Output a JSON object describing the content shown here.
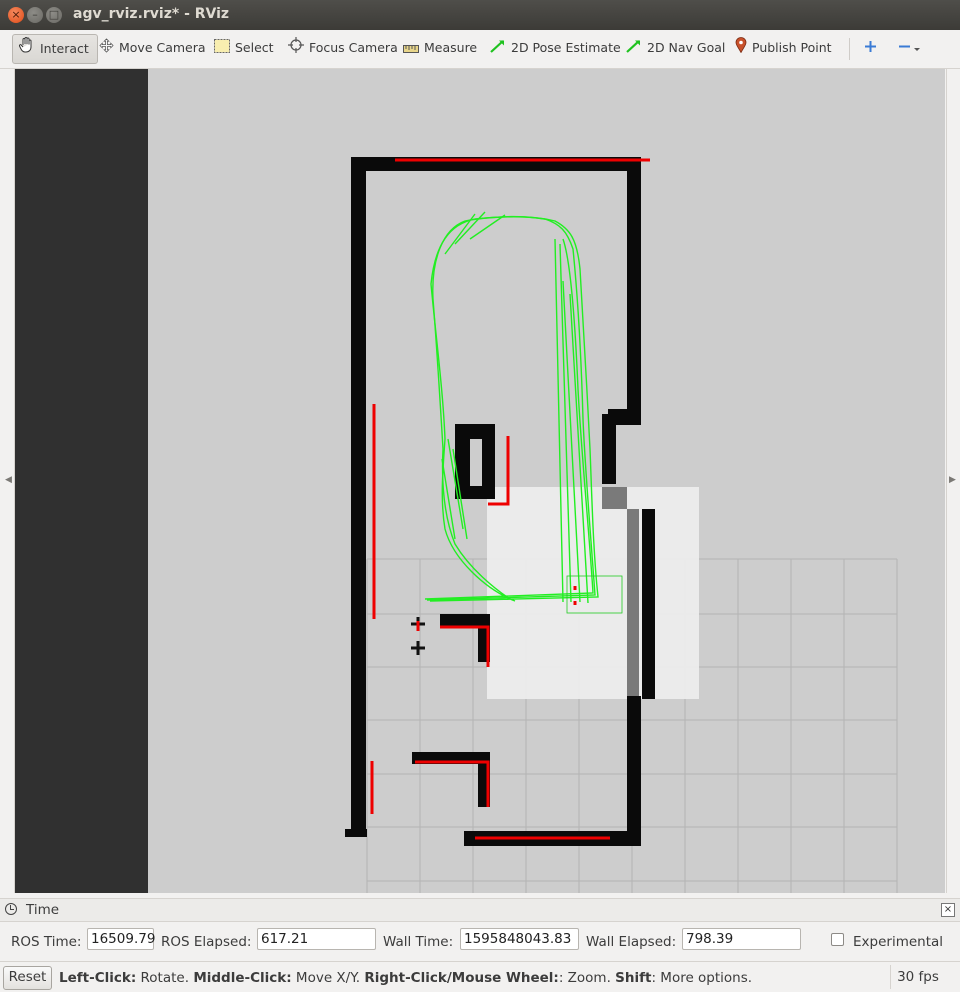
{
  "window": {
    "title": "agv_rviz.rviz* - RViz"
  },
  "window_controls": {
    "close": "×",
    "minimize": "–",
    "maximize": "□"
  },
  "toolbar": {
    "tools": [
      {
        "label": "Interact",
        "icon": "hand-icon",
        "active": true
      },
      {
        "label": "Move Camera",
        "icon": "move-camera-icon"
      },
      {
        "label": "Select",
        "icon": "select-box-icon"
      },
      {
        "label": "Focus Camera",
        "icon": "crosshair-icon"
      },
      {
        "label": "Measure",
        "icon": "ruler-icon"
      },
      {
        "label": "2D Pose Estimate",
        "icon": "green-arrow-icon"
      },
      {
        "label": "2D Nav Goal",
        "icon": "green-arrow-icon"
      },
      {
        "label": "Publish Point",
        "icon": "map-pin-icon"
      }
    ],
    "add_tool_icon": "plus-icon",
    "remove_tool_icon": "minus-icon"
  },
  "viewport": {
    "content": "2D occupancy grid map with laser scan (red), robot trajectory (green), costmap (white) and grid",
    "colors": {
      "background": "#303030",
      "map_free": "#cdcdcd",
      "walls": "#000000",
      "laser": "#ff0000",
      "path": "#00ff00"
    }
  },
  "time_panel": {
    "title": "Time",
    "ros_time_label": "ROS Time:",
    "ros_time": "16509.79",
    "ros_elapsed_label": "ROS Elapsed:",
    "ros_elapsed": "617.21",
    "wall_time_label": "Wall Time:",
    "wall_time": "1595848043.83",
    "wall_elapsed_label": "Wall Elapsed:",
    "wall_elapsed": "798.39",
    "experimental_label": "Experimental",
    "experimental_checked": false
  },
  "status_bar": {
    "reset_label": "Reset",
    "hint_parts": [
      {
        "b": "Left-Click:",
        "t": " Rotate. "
      },
      {
        "b": "Middle-Click:",
        "t": " Move X/Y. "
      },
      {
        "b": "Right-Click/Mouse Wheel:",
        "t": ": Zoom. "
      },
      {
        "b": "Shift",
        "t": ": More options."
      }
    ],
    "fps": "30 fps"
  }
}
